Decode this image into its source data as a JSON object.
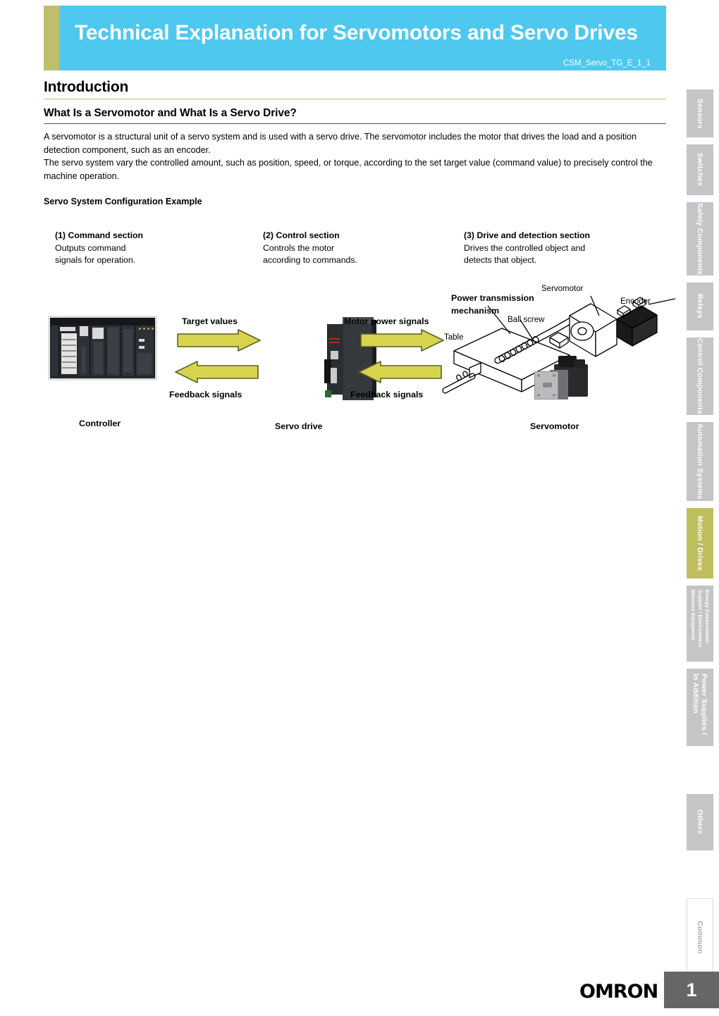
{
  "header": {
    "title": "Technical Explanation for Servomotors and Servo Drives",
    "code": "CSM_Servo_TG_E_1_1"
  },
  "content": {
    "h1": "Introduction",
    "h2": "What Is a Servomotor and What Is a Servo Drive?",
    "paragraph1": "A servomotor is a structural unit of a servo system and is used with a servo drive. The servomotor includes the motor that drives the load and a position detection component, such as an encoder.",
    "paragraph2": "The servo system vary the controlled amount, such as position, speed, or torque, according to the set target value (command value) to precisely control the machine operation.",
    "h3": "Servo System Configuration Example"
  },
  "sections": [
    {
      "title": "(1) Command section",
      "desc": "Outputs command\nsignals for operation."
    },
    {
      "title": "(2) Control section",
      "desc": "Controls the motor\naccording to commands."
    },
    {
      "title": "(3) Drive and detection section",
      "desc": "Drives the controlled object and\ndetects that object."
    }
  ],
  "diagram": {
    "controller_label": "Controller",
    "servo_drive_label": "Servo drive",
    "servomotor_label": "Servomotor",
    "target_values": "Target values",
    "feedback_signals_left": "Feedback signals",
    "motor_power_signals": "Motor power signals",
    "feedback_signals_right": "Feedback signals",
    "power_transmission": "Power transmission\nmechanism",
    "power_transmission_line1": "Power transmission",
    "power_transmission_line2": "mechanism",
    "ball_screw": "Ball screw",
    "table": "Table",
    "servomotor_callout": "Servomotor",
    "encoder_callout": "Encoder",
    "arrow_color": "#d6d44e",
    "arrow_outline": "#6b6a22"
  },
  "sidebar": {
    "tabs": [
      {
        "label": "Sensors",
        "active": false
      },
      {
        "label": "Switches",
        "active": false
      },
      {
        "label": "Safety Components",
        "active": false
      },
      {
        "label": "Relays",
        "active": false
      },
      {
        "label": "Control Components",
        "active": false
      },
      {
        "label": "Automation Systems",
        "active": false
      },
      {
        "label": "Motion / Drives",
        "active": true
      },
      {
        "label": "Energy Conservation Support / Environment Measure Equipment",
        "active": false
      },
      {
        "label": "Power Supplies / In Addition",
        "active": false
      },
      {
        "label": "Others",
        "active": false
      },
      {
        "label": "Common",
        "active": false
      }
    ]
  },
  "footer": {
    "logo": "OMRON",
    "page_number": "1"
  },
  "colors": {
    "banner_blue": "#4ec8ef",
    "olive": "#bfbe6e",
    "active_tab": "#bfbe5f",
    "tab_gray": "#c3c5c7",
    "page_box": "#666666"
  }
}
